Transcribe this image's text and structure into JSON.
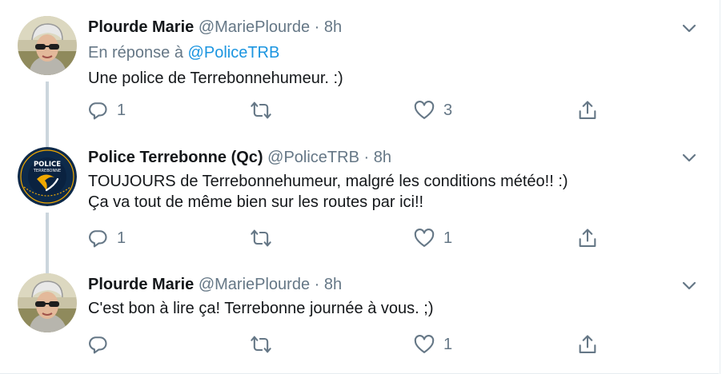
{
  "tweets": [
    {
      "display_name": "Plourde Marie",
      "handle": "@MariePlourde",
      "separator": "·",
      "time": "8h",
      "reply_prefix": "En réponse à",
      "reply_mention": "@PoliceTRB",
      "lines": [
        "Une police de Terrebonnehumeur. :)"
      ],
      "reply_count": "1",
      "retweet_count": "",
      "like_count": "3"
    },
    {
      "display_name": "Police Terrebonne (Qc)",
      "handle": "@PoliceTRB",
      "separator": "·",
      "time": "8h",
      "lines": [
        "TOUJOURS de Terrebonnehumeur, malgré les conditions météo!! :)",
        "Ça va tout de même bien sur les routes par ici!!"
      ],
      "reply_count": "1",
      "retweet_count": "",
      "like_count": "1",
      "avatar_logo": {
        "top": "POLICE",
        "middle": "TERREBONNE"
      }
    },
    {
      "display_name": "Plourde Marie",
      "handle": "@MariePlourde",
      "separator": "·",
      "time": "8h",
      "lines": [
        "C'est bon à lire ça! Terrebonne journée à vous. ;)"
      ],
      "reply_count": "",
      "retweet_count": "",
      "like_count": "1"
    }
  ],
  "icons": {
    "reply": "reply-icon",
    "retweet": "retweet-icon",
    "like": "like-icon",
    "share": "share-icon",
    "more": "chevron-down-icon"
  },
  "colors": {
    "text": "#14171a",
    "secondary": "#657786",
    "link": "#1b95e0",
    "thread_line": "#ccd6dd",
    "police_navy": "#0d2a4a",
    "police_gold": "#f0a800"
  }
}
